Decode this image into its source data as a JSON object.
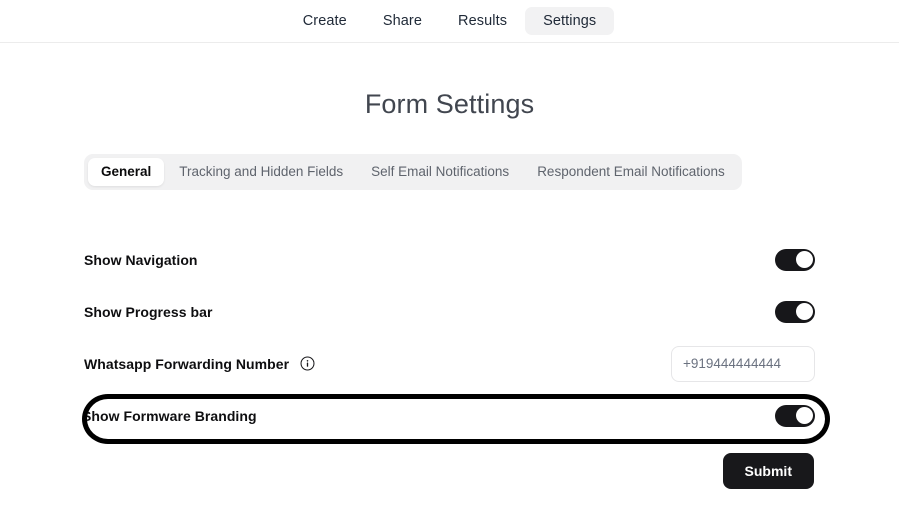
{
  "topnav": {
    "items": [
      {
        "label": "Create",
        "active": false
      },
      {
        "label": "Share",
        "active": false
      },
      {
        "label": "Results",
        "active": false
      },
      {
        "label": "Settings",
        "active": true
      }
    ]
  },
  "page": {
    "title": "Form Settings"
  },
  "tabs": [
    {
      "label": "General",
      "active": true
    },
    {
      "label": "Tracking and Hidden Fields",
      "active": false
    },
    {
      "label": "Self Email Notifications",
      "active": false
    },
    {
      "label": "Respondent Email Notifications",
      "active": false
    }
  ],
  "settings": {
    "rows": [
      {
        "label": "Show Navigation",
        "control": "toggle",
        "toggle_state": "on",
        "has_info_icon": false
      },
      {
        "label": "Show Progress bar",
        "control": "toggle",
        "toggle_state": "on",
        "has_info_icon": false
      },
      {
        "label": "Whatsapp Forwarding Number",
        "control": "text-input",
        "has_info_icon": true,
        "info_icon": "info-circle-icon",
        "input_value": "",
        "input_placeholder": "+919444444444"
      },
      {
        "label": "Show Formware Branding",
        "control": "toggle",
        "toggle_state": "on",
        "has_info_icon": false,
        "annotated": true
      }
    ]
  },
  "footer": {
    "submit_label": "Submit"
  },
  "colors": {
    "accent": "#18181b",
    "toggle_on": "#17171a",
    "title": "#41464f",
    "tabbar_bg": "#f1f1f2",
    "nav_active_bg": "#f2f2f3",
    "annotation": "#000000",
    "border": "#e6e6e8",
    "placeholder": "#6b7280"
  }
}
